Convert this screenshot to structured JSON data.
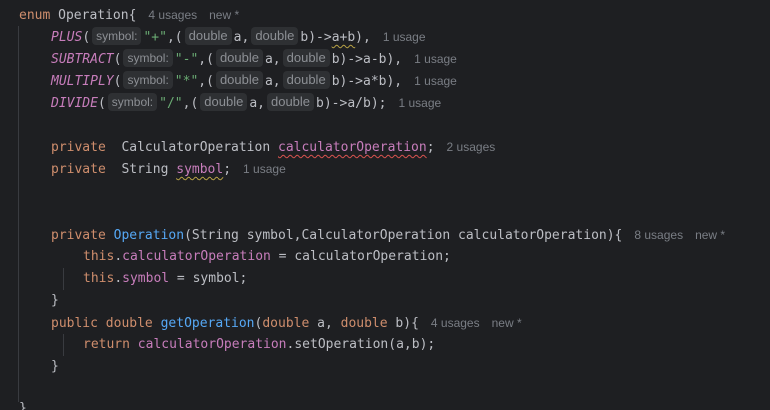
{
  "code": {
    "l1": {
      "kw": "enum",
      "name": "Operation",
      "brace": "{",
      "usage": "4 usages",
      "author": "new *"
    },
    "l2": {
      "const": "PLUS",
      "p1": "(",
      "hint_symbol": "symbol:",
      "str": "\"+\"",
      "p2": ",(",
      "type1": "double",
      "a": "a,",
      "type2": "double",
      "b": "b)->",
      "expr": "a+b",
      "end": "),",
      "usage": "1 usage"
    },
    "l3": {
      "const": "SUBTRACT",
      "p1": "(",
      "hint_symbol": "symbol:",
      "str": "\"-\"",
      "p2": ",(",
      "type1": "double",
      "a": "a,",
      "type2": "double",
      "b": "b)->a-b),",
      "usage": "1 usage"
    },
    "l4": {
      "const": "MULTIPLY",
      "p1": "(",
      "hint_symbol": "symbol:",
      "str": "\"*\"",
      "p2": ",(",
      "type1": "double",
      "a": "a,",
      "type2": "double",
      "b": "b)->a*b),",
      "usage": "1 usage"
    },
    "l5": {
      "const": "DIVIDE",
      "p1": "(",
      "hint_symbol": "symbol:",
      "str": "\"/\"",
      "p2": ",(",
      "type1": "double",
      "a": "a,",
      "type2": "double",
      "b": "b)->a/b);",
      "usage": "1 usage"
    },
    "l7": {
      "kw": "private",
      "type": "CalculatorOperation",
      "field": "calculatorOperation",
      "semi": ";",
      "usage": "2 usages"
    },
    "l8": {
      "kw": "private",
      "type": "String",
      "field": "symbol",
      "semi": ";",
      "usage": "1 usage"
    },
    "l11": {
      "kw": "private",
      "fn": "Operation",
      "params": "(String symbol,CalculatorOperation calculatorOperation){",
      "usage": "8 usages",
      "author": "new *"
    },
    "l12": {
      "kw": "this",
      "dot": ".",
      "field": "calculatorOperation",
      "rest": " = calculatorOperation;"
    },
    "l13": {
      "kw": "this",
      "dot": ".",
      "field": "symbol",
      "rest": " = symbol;"
    },
    "l14": {
      "brace": "}"
    },
    "l15": {
      "kw1": "public",
      "kw2": "double",
      "fn": "getOperation",
      "p_open": "(",
      "t1": "double",
      "a": " a, ",
      "t2": "double",
      "b": " b){",
      "usage": "4 usages",
      "author": "new *"
    },
    "l16": {
      "kw": "return",
      "field": "calculatorOperation",
      "rest": ".setOperation(a,b);"
    },
    "l17": {
      "brace": "}"
    },
    "l19": {
      "brace": "}"
    }
  }
}
